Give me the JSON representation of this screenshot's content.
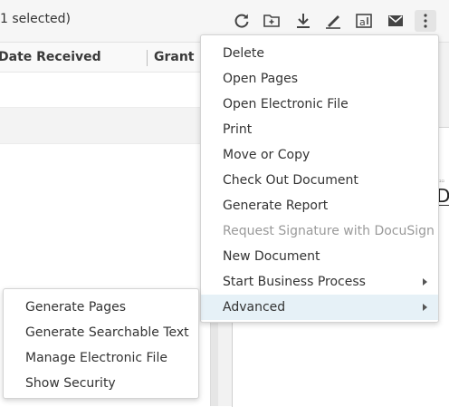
{
  "toolbar": {
    "selection_text": "1 selected)",
    "icons": [
      "refresh-icon",
      "new-folder-icon",
      "download-icon",
      "sign-icon",
      "text-recognition-icon",
      "mail-icon",
      "more-vertical-icon"
    ]
  },
  "table": {
    "columns": [
      "Date Received",
      "Grant"
    ]
  },
  "menu": {
    "items": [
      {
        "label": "Delete"
      },
      {
        "label": "Open Pages"
      },
      {
        "label": "Open Electronic File"
      },
      {
        "label": "Print"
      },
      {
        "label": "Move or Copy"
      },
      {
        "label": "Check Out Document"
      },
      {
        "label": "Generate Report"
      },
      {
        "label": "Request Signature with DocuSign",
        "disabled": true
      },
      {
        "label": "New Document"
      },
      {
        "label": "Start Business Process",
        "submenu": true
      },
      {
        "label": "Advanced",
        "submenu": true,
        "active": true
      }
    ]
  },
  "submenu": {
    "items": [
      {
        "label": "Generate Pages"
      },
      {
        "label": "Generate Searchable Text"
      },
      {
        "label": "Manage Electronic File"
      },
      {
        "label": "Show Security"
      }
    ]
  },
  "preview": {
    "visible_letter": "D"
  },
  "colors": {
    "toolbar_bg": "#f6f6f6",
    "menu_active_bg": "#e6f1f7",
    "disabled_text": "#9a9a9a"
  }
}
